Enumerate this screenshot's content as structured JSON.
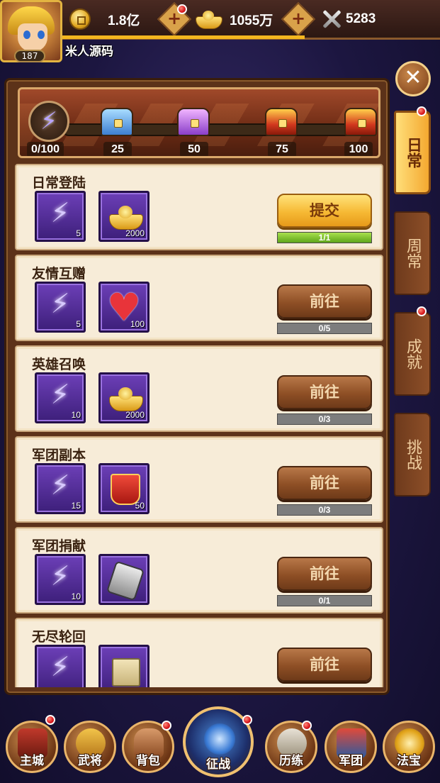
{
  "header": {
    "level": "187",
    "player_name": "米人源码",
    "copper": "1.8亿",
    "gold": "1055万",
    "power": "5283",
    "plus_symbol": "+"
  },
  "progress": {
    "current": "0/100",
    "milestones": [
      "25",
      "50",
      "75",
      "100"
    ]
  },
  "tasks": [
    {
      "title": "日常登陆",
      "reward1_qty": "5",
      "reward2_qty": "2000",
      "button": "提交",
      "progress": "1/1",
      "fill": 1.0
    },
    {
      "title": "友情互赠",
      "reward1_qty": "5",
      "reward2_qty": "100",
      "button": "前往",
      "progress": "0/5",
      "fill": 0.0
    },
    {
      "title": "英雄召唤",
      "reward1_qty": "10",
      "reward2_qty": "2000",
      "button": "前往",
      "progress": "0/3",
      "fill": 0.0
    },
    {
      "title": "军团副本",
      "reward1_qty": "15",
      "reward2_qty": "50",
      "button": "前往",
      "progress": "0/3",
      "fill": 0.0
    },
    {
      "title": "军团捐献",
      "reward1_qty": "10",
      "reward2_qty": "",
      "button": "前往",
      "progress": "0/1",
      "fill": 0.0
    },
    {
      "title": "无尽轮回",
      "reward1_qty": "",
      "reward2_qty": "",
      "button": "前往",
      "progress": "",
      "fill": 0.0
    }
  ],
  "side_tabs": [
    {
      "label": "日常",
      "active": true,
      "badge": true
    },
    {
      "label": "周常",
      "active": false,
      "badge": false
    },
    {
      "label": "成就",
      "active": false,
      "badge": true
    },
    {
      "label": "挑战",
      "active": false,
      "badge": false
    }
  ],
  "close_label": "✕",
  "nav": [
    {
      "label": "主城",
      "badge": true
    },
    {
      "label": "武将",
      "badge": false
    },
    {
      "label": "背包",
      "badge": true
    },
    {
      "label": "征战",
      "badge": true
    },
    {
      "label": "历练",
      "badge": true
    },
    {
      "label": "军团",
      "badge": false
    },
    {
      "label": "法宝",
      "badge": false
    }
  ],
  "icons": {
    "bolt": "⚡",
    "heart": "♥"
  },
  "colors": {
    "accent_gold": "#f3b61f",
    "badge_red": "#d8181e",
    "progress_green": "#5ea51a"
  }
}
